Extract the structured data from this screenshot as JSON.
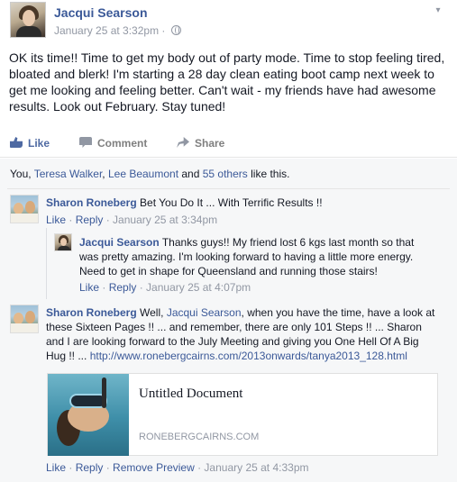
{
  "post": {
    "author": "Jacqui Searson",
    "timestamp": "January 25 at 3:32pm",
    "separator": "·",
    "body": "OK its time!! Time to get my body out of party mode. Time to stop feeling tired, bloated and blerk! I'm starting a 28 day clean eating boot camp next week to get me looking and feeling better. Can't wait - my friends have had awesome results. Look out February. Stay tuned!"
  },
  "actions": {
    "like": "Like",
    "comment": "Comment",
    "share": "Share"
  },
  "likes": {
    "prefix": "You, ",
    "name1": "Teresa Walker",
    "comma": ", ",
    "name2": "Lee Beaumont",
    "and": " and ",
    "others": "55 others",
    "suffix": " like this."
  },
  "comments": [
    {
      "author": "Sharon Roneberg",
      "text": " Bet You Do It ... With Terrific Results !!",
      "like": "Like",
      "reply": "Reply",
      "time": "January 25 at 3:34pm"
    },
    {
      "author": "Jacqui Searson",
      "text": " Thanks guys!! My friend lost 6 kgs last month so that was pretty amazing. I'm looking forward to having a little more energy. Need to get in shape for Queensland and running those stairs!",
      "like": "Like",
      "reply": "Reply",
      "time": "January 25 at 4:07pm"
    },
    {
      "author": "Sharon Roneberg",
      "text_a": " Well, ",
      "mention": "Jacqui Searson",
      "text_b": ", when you have the time, have a look at these Sixteen Pages !! ... and remember, there are only 101 Steps !! ... Sharon and I are looking forward to the July Meeting and giving you One Hell Of A Big Hug !! ... ",
      "url": "http://www.ronebergcairns.com/2013onwards/tanya2013_128.html",
      "like": "Like",
      "reply": "Reply",
      "remove_preview": "Remove Preview",
      "time": "January 25 at 4:33pm"
    }
  ],
  "link_preview": {
    "title": "Untitled Document",
    "domain": "RONEBERGCAIRNS.COM"
  },
  "colors": {
    "link": "#3b5998",
    "meta": "#9197a3",
    "ufi_bg": "#f6f7f8"
  }
}
